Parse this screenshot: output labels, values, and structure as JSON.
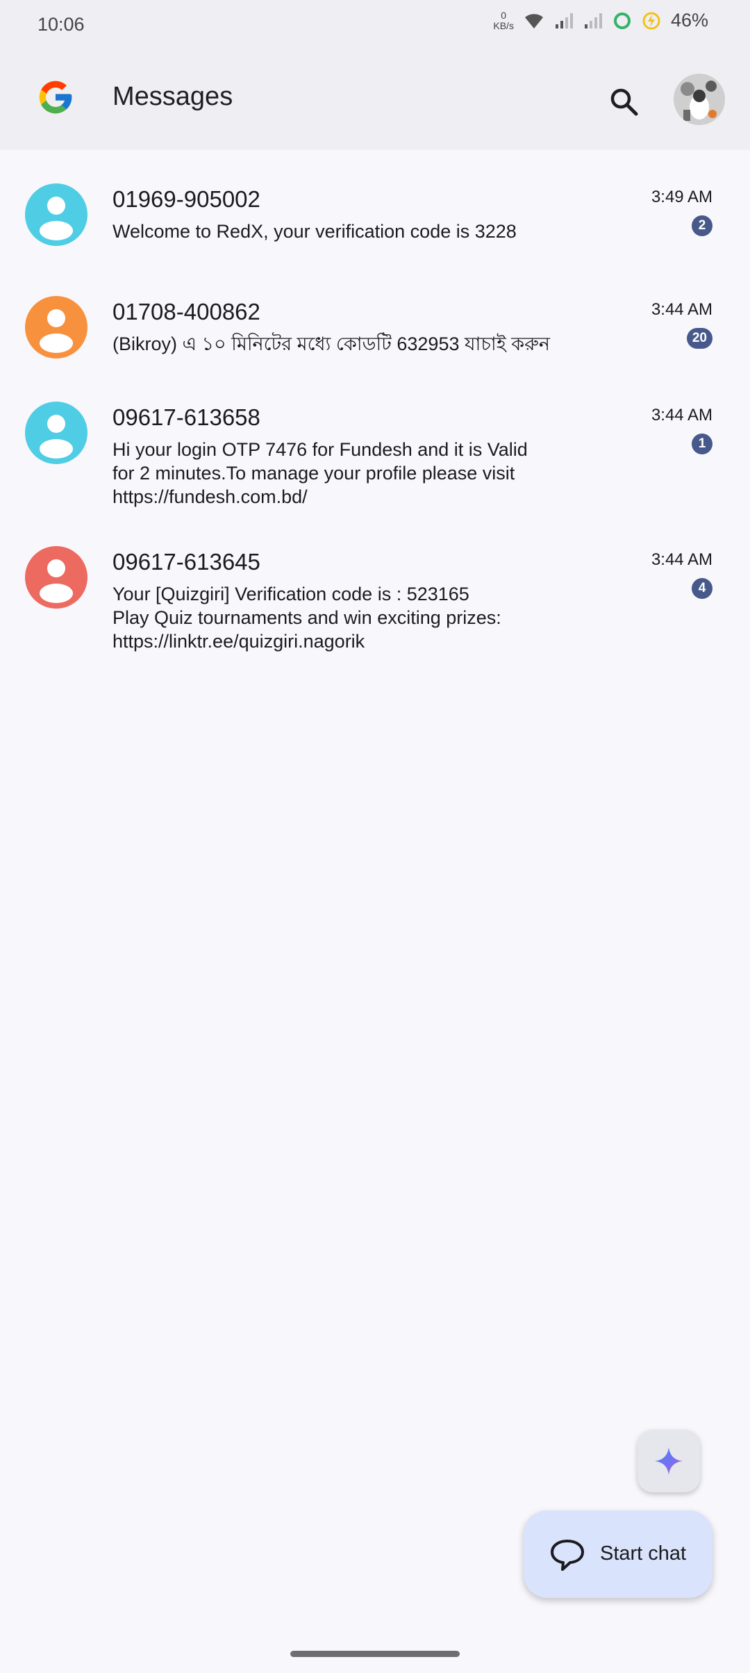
{
  "status_bar": {
    "time": "10:06",
    "net_speed_value": "0",
    "net_speed_unit": "KB/s",
    "battery_percent": "46%"
  },
  "app_bar": {
    "title": "Messages"
  },
  "colors": {
    "accent": "#46598a",
    "avatar_cyan": "#4fcde4",
    "avatar_orange": "#f8913e",
    "avatar_red": "#ec6a60",
    "fab_bg": "#d9e3fb"
  },
  "conversations": [
    {
      "name": "01969-905002",
      "snippet": "Welcome to RedX, your verification code is 3228",
      "time": "3:49 AM",
      "unread": "2",
      "avatar_color": "#4fcde4"
    },
    {
      "name": "01708-400862",
      "snippet": "(Bikroy) এ ১০ মিনিটের মধ্যে কোডটি 632953 যাচাই করুন",
      "time": "3:44 AM",
      "unread": "20",
      "avatar_color": "#f8913e"
    },
    {
      "name": "09617-613658",
      "snippet": "Hi your login OTP 7476 for Fundesh and it is Valid\nfor 2 minutes.To manage your profile please visit\nhttps://fundesh.com.bd/",
      "time": "3:44 AM",
      "unread": "1",
      "avatar_color": "#4fcde4"
    },
    {
      "name": "09617-613645",
      "snippet": "Your [Quizgiri] Verification code is : 523165\nPlay Quiz tournaments and win exciting prizes:\nhttps://linktr.ee/quizgiri.nagorik",
      "time": "3:44 AM",
      "unread": "4",
      "avatar_color": "#ec6a60"
    }
  ],
  "fab": {
    "start_chat_label": "Start chat",
    "gemini_icon": "sparkle-icon"
  }
}
